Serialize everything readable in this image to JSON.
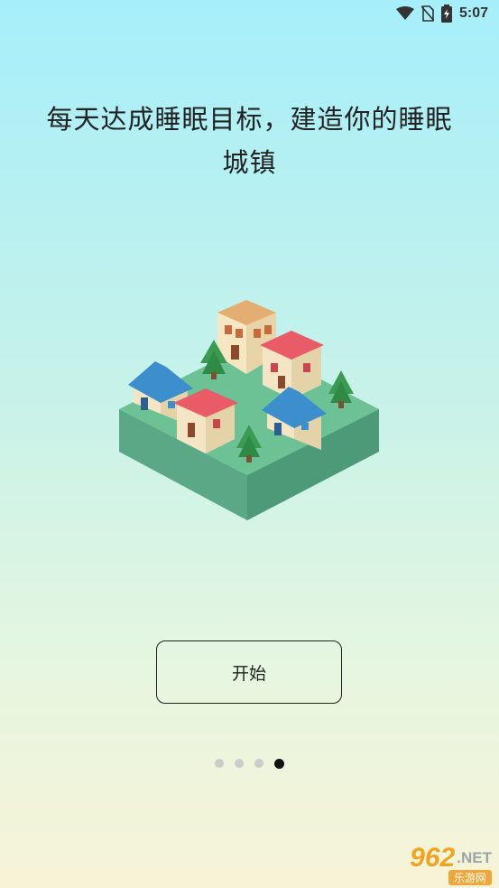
{
  "status_bar": {
    "time": "5:07",
    "icons": [
      "wifi-icon",
      "no-sim-icon",
      "battery-charging-icon"
    ]
  },
  "onboarding": {
    "headline": "每天达成睡眠目标，建造你的睡眠城镇",
    "start_label": "开始",
    "pages_total": 4,
    "current_page": 4
  },
  "watermark": {
    "number": "962",
    "suffix": ".NET",
    "subtitle": "乐游网"
  },
  "colors": {
    "accent_dot": "#111111",
    "inactive_dot": "#c9cccc",
    "ground": "#6cc295"
  }
}
